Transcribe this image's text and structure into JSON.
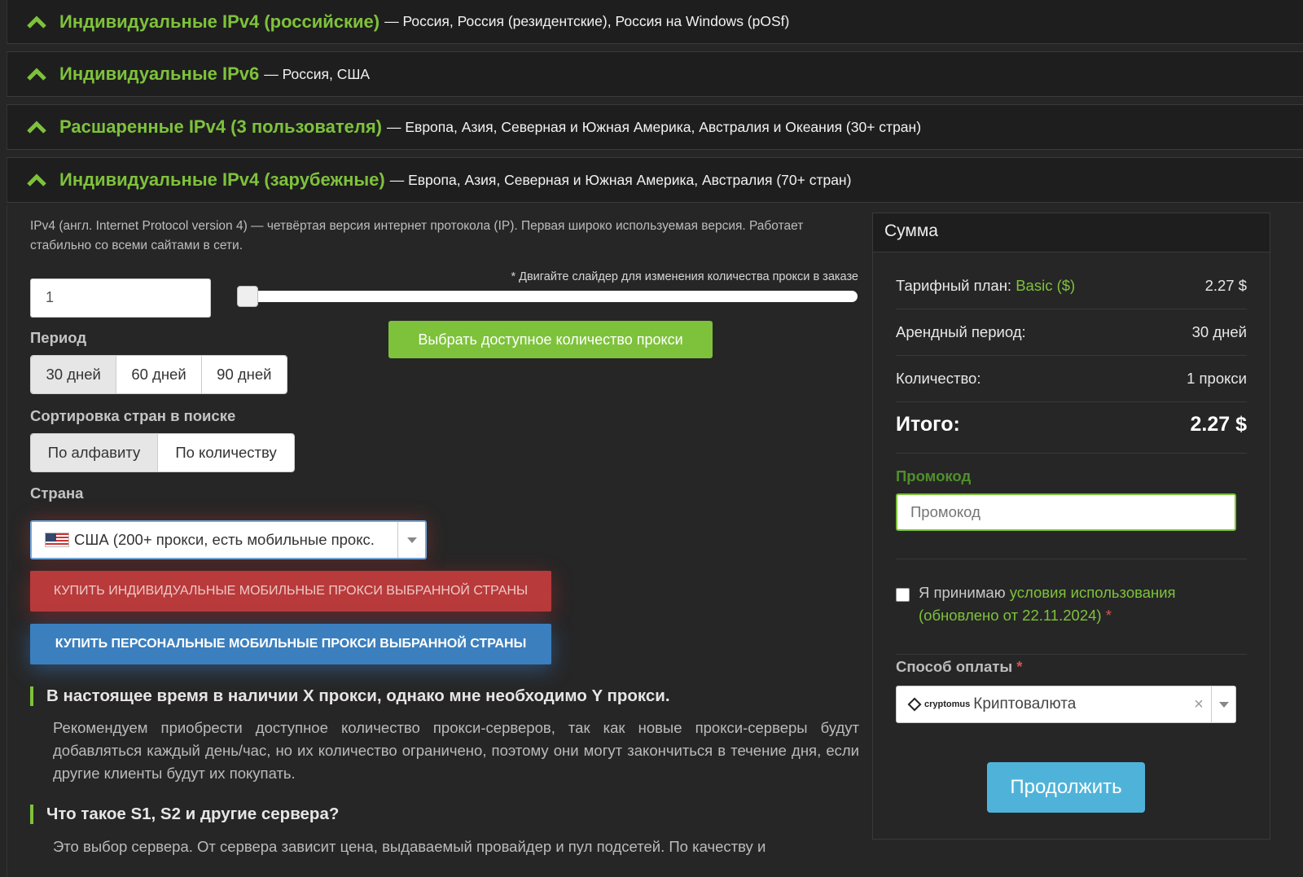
{
  "accordions": [
    {
      "title": "Индивидуальные IPv4 (российские)",
      "desc": "— Россия, Россия (резидентские), Россия на Windows (pOSf)"
    },
    {
      "title": "Индивидуальные IPv6",
      "desc": "— Россия, США"
    },
    {
      "title": "Расшаренные IPv4 (3 пользователя)",
      "desc": "— Европа, Азия, Северная и Южная Америка, Австралия и Океания (30+ стран)"
    },
    {
      "title": "Индивидуальные IPv4 (зарубежные)",
      "desc": "— Европа, Азия, Северная и Южная Америка, Австралия (70+ стран)"
    }
  ],
  "main": {
    "intro": "IPv4 (англ. Internet Protocol version 4) — четвёртая версия интернет протокола (IP). Первая широко используемая версия. Работает стабильно со всеми сайтами в сети.",
    "quantity_value": "1",
    "slider_hint": "* Двигайте слайдер для изменения количества прокси в заказе",
    "slider_value": 1,
    "select_available_button": "Выбрать доступное количество прокси",
    "period_label": "Период",
    "periods": [
      "30 дней",
      "60 дней",
      "90 дней"
    ],
    "sort_label": "Сортировка стран в поиске",
    "sort_options": [
      "По алфавиту",
      "По количеству"
    ],
    "country_label": "Страна",
    "country_selected": "США (200+ прокси, есть мобильные прокс.",
    "buy_individual_mobile": "КУПИТЬ ИНДИВИДУАЛЬНЫЕ МОБИЛЬНЫЕ ПРОКСИ ВЫБРАННОЙ СТРАНЫ",
    "buy_personal_mobile": "КУПИТЬ ПЕРСОНАЛЬНЫЕ МОБИЛЬНЫЕ ПРОКСИ ВЫБРАННОЙ СТРАНЫ",
    "faq": [
      {
        "q": "В настоящее время в наличии X прокси, однако мне необходимо Y прокси.",
        "a": "Рекомендуем приобрести доступное количество прокси-серверов, так как новые прокси-серверы будут добавляться каждый день/час, но их количество ограничено, поэтому они могут закончиться в течение дня, если другие клиенты будут их покупать."
      },
      {
        "q": "Что такое S1, S2 и другие сервера?",
        "a": "Это выбор сервера. От сервера зависит цена, выдаваемый провайдер и пул подсетей. По качеству и"
      }
    ]
  },
  "summary": {
    "title": "Сумма",
    "plan_label": "Тарифный план:",
    "plan_name": "Basic ($)",
    "plan_price": "2.27 $",
    "period_label": "Арендный период:",
    "period_value": "30 дней",
    "qty_label": "Количество:",
    "qty_value": "1 прокси",
    "total_label": "Итого:",
    "total_value": "2.27 $",
    "promo_label": "Промокод",
    "promo_placeholder": "Промокод",
    "terms_prefix": "Я принимаю",
    "terms_link": "условия использования (обновлено от 22.11.2024)",
    "required_mark": "*",
    "payment_label": "Способ оплаты",
    "payment_logo": "cryptomus",
    "payment_value": "Криптовалюта",
    "clear_symbol": "×",
    "continue_button": "Продолжить"
  },
  "colors": {
    "accent": "#7ec23b",
    "red_button": "#b83a3a",
    "blue_button": "#3b7fbe",
    "continue": "#4fb3d9",
    "background": "#262626"
  }
}
